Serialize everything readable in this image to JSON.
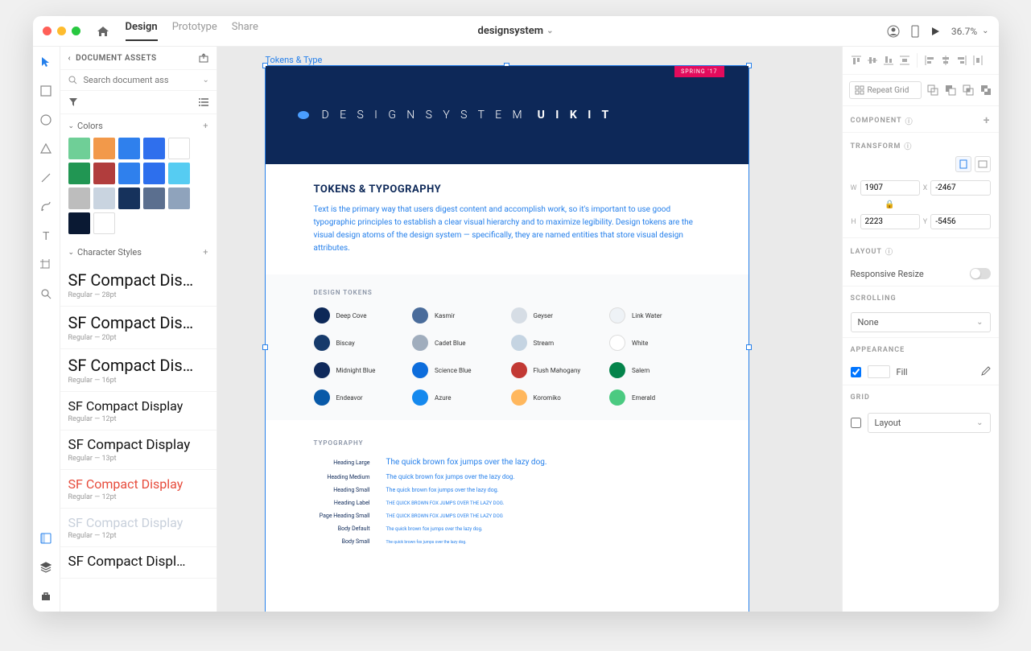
{
  "titlebar": {
    "tabs": [
      "Design",
      "Prototype",
      "Share"
    ],
    "active_tab": 0,
    "document": "designsystem",
    "zoom": "36.7%"
  },
  "left_panel": {
    "header": "DOCUMENT ASSETS",
    "search_placeholder": "Search document ass",
    "colors_label": "Colors",
    "colors": [
      "#6fcf97",
      "#f2994a",
      "#2f80ed",
      "#2f6fed",
      "#ffffff",
      "#219653",
      "#b13d3d",
      "#2f80ed",
      "#2d6fed",
      "#56ccf2",
      "#bdbdbd",
      "#c9d4e0",
      "#16325c",
      "#5b6f8f",
      "#8fa3bc",
      "#0a1933",
      "#ffffff"
    ],
    "char_label": "Character Styles",
    "char_styles": [
      {
        "name": "SF Compact Dis…",
        "meta": "Regular — 28pt",
        "size": 20,
        "color": "#111"
      },
      {
        "name": "SF Compact Dis…",
        "meta": "Regular — 20pt",
        "size": 20,
        "color": "#111"
      },
      {
        "name": "SF Compact Dis…",
        "meta": "Regular — 16pt",
        "size": 20,
        "color": "#111"
      },
      {
        "name": "SF Compact Display",
        "meta": "Regular — 12pt",
        "size": 16,
        "color": "#111"
      },
      {
        "name": "SF Compact Display",
        "meta": "Regular — 13pt",
        "size": 17,
        "color": "#111"
      },
      {
        "name": "SF Compact Display",
        "meta": "Regular — 12pt",
        "size": 16,
        "color": "#e74c3c"
      },
      {
        "name": "SF Compact Display",
        "meta": "Regular — 12pt",
        "size": 16,
        "color": "#c8d0db"
      },
      {
        "name": "SF Compact Displ…",
        "meta": "",
        "size": 17,
        "color": "#111"
      }
    ]
  },
  "canvas": {
    "artboard_label": "Tokens & Type",
    "badge": "SPRING '17",
    "hero_line1": "D E S I G N   S Y S T E M",
    "hero_line2": "U I   K I T",
    "section1_title": "TOKENS & TYPOGRAPHY",
    "section1_body": "Text is the primary way that users digest content and accomplish work, so it's important to use good typographic principles to establish a clear visual hierarchy and to maximize legibility. Design tokens are the visual design atoms of the design system — specifically, they are named entities that store visual design attributes.",
    "tokens_head": "DESIGN TOKENS",
    "tokens": [
      {
        "name": "Deep Cove",
        "c": "#0d2858"
      },
      {
        "name": "Kasmir",
        "c": "#4a6c9b"
      },
      {
        "name": "Geyser",
        "c": "#d6dde5"
      },
      {
        "name": "Link Water",
        "c": "#eef2f6",
        "outline": true
      },
      {
        "name": "Biscay",
        "c": "#163a6b"
      },
      {
        "name": "Cadet Blue",
        "c": "#a0adbd"
      },
      {
        "name": "Stream",
        "c": "#c5d4e2"
      },
      {
        "name": "White",
        "c": "#ffffff",
        "outline": true
      },
      {
        "name": "Midnight Blue",
        "c": "#102a5c"
      },
      {
        "name": "Science Blue",
        "c": "#0d6ddc"
      },
      {
        "name": "Flush Mahogany",
        "c": "#c23934"
      },
      {
        "name": "Salem",
        "c": "#04844b"
      },
      {
        "name": "Endeavor",
        "c": "#0859a8"
      },
      {
        "name": "Azure",
        "c": "#1589ee"
      },
      {
        "name": "Koromiko",
        "c": "#ffb75d"
      },
      {
        "name": "Emerald",
        "c": "#4bca81"
      }
    ],
    "typo_head": "TYPOGRAPHY",
    "typo_rows": [
      {
        "label": "Heading Large",
        "sample": "The quick brown fox jumps over the lazy dog.",
        "size": 10
      },
      {
        "label": "Heading Medium",
        "sample": "The quick brown fox jumps over the lazy dog.",
        "size": 8
      },
      {
        "label": "Heading Small",
        "sample": "The quick brown fox jumps over the lazy dog.",
        "size": 7
      },
      {
        "label": "Heading Label",
        "sample": "THE QUICK BROWN FOX JUMPS OVER THE LAZY DOG.",
        "size": 6
      },
      {
        "label": "Page Heading Small",
        "sample": "THE QUICK BROWN FOX JUMPS OVER THE LAZY DOG",
        "size": 6
      },
      {
        "label": "Body Default",
        "sample": "The quick brown fox jumps over the lazy dog.",
        "size": 6
      },
      {
        "label": "Body Small",
        "sample": "The quick brown fox jumps over the lazy dog.",
        "size": 5
      }
    ]
  },
  "right_panel": {
    "repeat_label": "Repeat Grid",
    "component_label": "COMPONENT",
    "transform_label": "TRANSFORM",
    "w": "1907",
    "h": "2223",
    "x": "-2467",
    "y": "-5456",
    "layout_label": "LAYOUT",
    "resize_label": "Responsive Resize",
    "scrolling_label": "SCROLLING",
    "scroll_value": "None",
    "appearance_label": "APPEARANCE",
    "fill_label": "Fill",
    "grid_label": "GRID",
    "grid_value": "Layout"
  }
}
